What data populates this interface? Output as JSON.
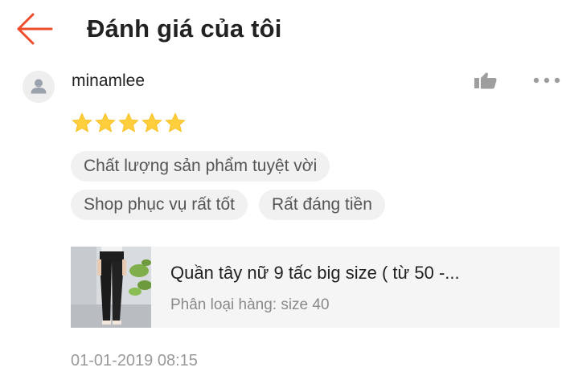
{
  "header": {
    "title": "Đánh giá của tôi",
    "back_icon": "arrow-left-icon"
  },
  "review": {
    "avatar_icon": "user-avatar-icon",
    "username": "minamlee",
    "like_icon": "thumbs-up-icon",
    "more_icon": "more-dots-icon",
    "rating": 5,
    "rating_max": 5,
    "tags": [
      "Chất lượng sản phẩm tuyệt vời",
      "Shop phục vụ rất tốt",
      "Rất đáng tiền"
    ],
    "product": {
      "name": "Quần tây nữ 9 tấc big size ( từ 50 -...",
      "variant": "Phân loại hàng: size 40"
    },
    "timestamp": "01-01-2019 08:15"
  },
  "colors": {
    "accent": "#ee4d2d",
    "star": "#ffce3d",
    "tag_bg": "#f1f1f1",
    "card_bg": "#f5f5f5"
  }
}
